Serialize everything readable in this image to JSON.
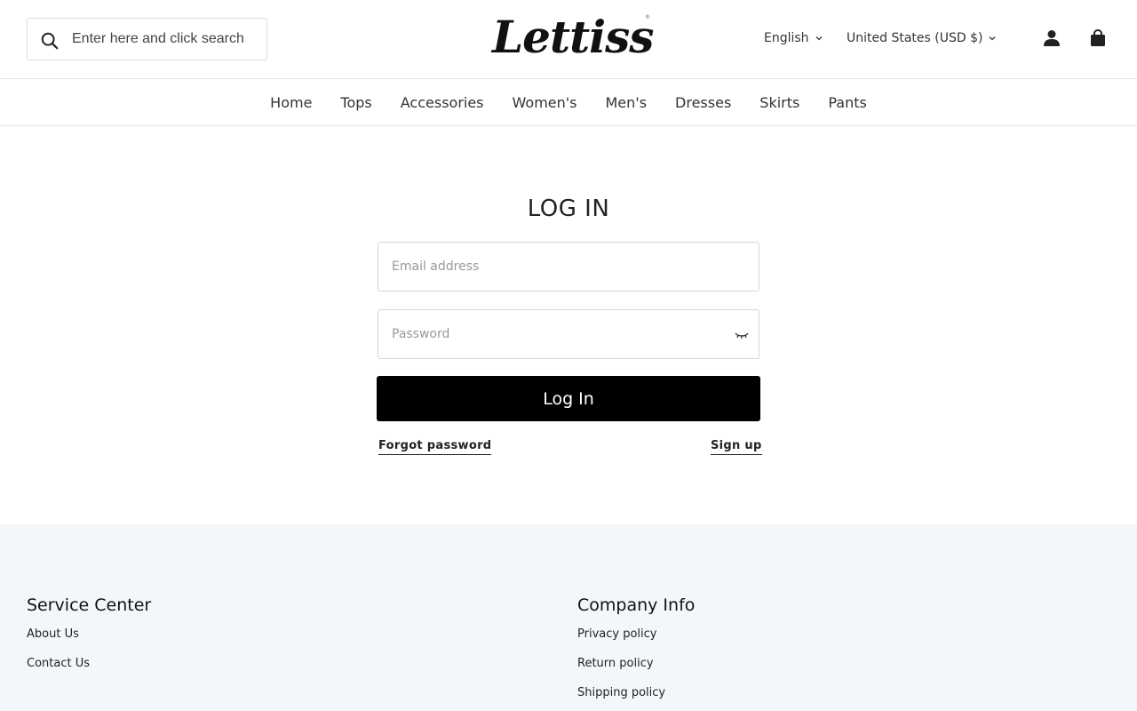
{
  "header": {
    "search_placeholder": "Enter here and click search",
    "logo_text": "Lettiss",
    "logo_mark": "®",
    "language": "English",
    "currency": "United States (USD $)",
    "icons": {
      "search": "search-icon",
      "account": "user-icon",
      "cart": "shopping-bag-icon"
    }
  },
  "nav": {
    "items": [
      "Home",
      "Tops",
      "Accessories",
      "Women's",
      "Men's",
      "Dresses",
      "Skirts",
      "Pants"
    ]
  },
  "login": {
    "title": "LOG IN",
    "email_placeholder": "Email address",
    "password_placeholder": "Password",
    "submit_label": "Log In",
    "forgot_label": "Forgot password",
    "signup_label": "Sign up"
  },
  "footer": {
    "columns": [
      {
        "heading": "Service Center",
        "links": [
          "About Us",
          "Contact Us"
        ]
      },
      {
        "heading": "Company Info",
        "links": [
          "Privacy policy",
          "Return policy",
          "Shipping policy"
        ]
      }
    ]
  },
  "colors": {
    "primary_button": "#000000",
    "footer_background": "#f4f7f9",
    "border": "#d6d6d6"
  }
}
